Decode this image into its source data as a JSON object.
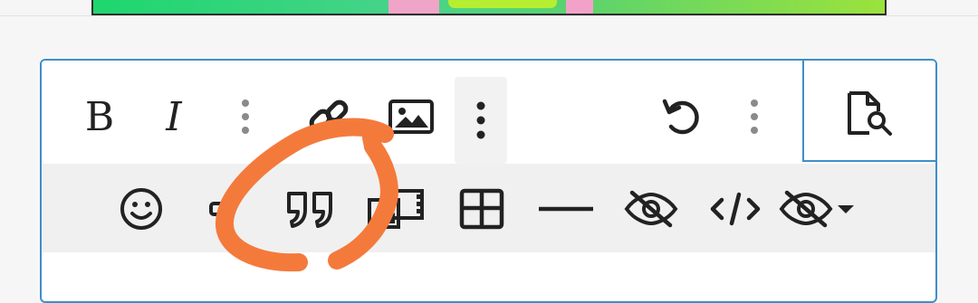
{
  "colors": {
    "border_accent": "#3d8fc9",
    "toolbar_secondary_bg": "#f0f0f0",
    "icon": "#222222",
    "separator_dots": "#8a8a8a",
    "annotation_stroke": "#f47a3c"
  },
  "toolbar_primary": [
    {
      "name": "bold-button",
      "icon": "bold-icon"
    },
    {
      "name": "italic-button",
      "icon": "italic-icon"
    },
    {
      "name": "separator-dots",
      "icon": "vertical-dots-icon"
    },
    {
      "name": "link-button",
      "icon": "link-icon"
    },
    {
      "name": "image-button",
      "icon": "image-icon"
    },
    {
      "name": "more-options-button",
      "icon": "vertical-dots-icon"
    },
    {
      "name": "undo-button",
      "icon": "undo-icon"
    },
    {
      "name": "separator-dots",
      "icon": "vertical-dots-icon"
    },
    {
      "name": "preview-button",
      "icon": "file-search-icon"
    }
  ],
  "toolbar_secondary": [
    {
      "name": "emoji-button",
      "icon": "smiley-icon"
    },
    {
      "name": "link-small-button",
      "icon": "link-icon"
    },
    {
      "name": "quote-button",
      "icon": "quote-icon"
    },
    {
      "name": "media-gallery-button",
      "icon": "media-icon"
    },
    {
      "name": "table-button",
      "icon": "table-icon"
    },
    {
      "name": "horizontal-rule-button",
      "icon": "horizontal-line-icon"
    },
    {
      "name": "spoiler-button",
      "icon": "eye-off-icon"
    },
    {
      "name": "code-button",
      "icon": "code-icon"
    },
    {
      "name": "hide-content-dropdown",
      "icon": "eye-off-caret-icon"
    }
  ],
  "annotation": {
    "shape": "freehand-circle-around-quote-button"
  }
}
